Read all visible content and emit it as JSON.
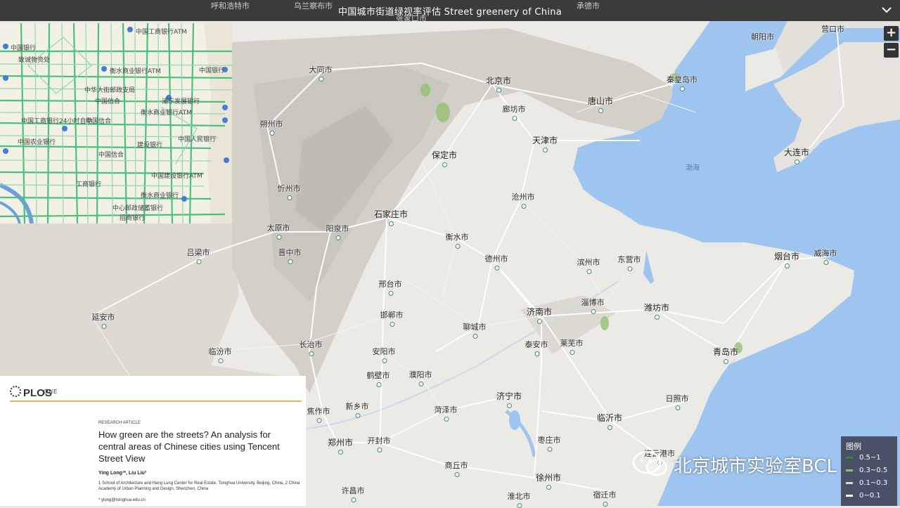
{
  "title": "中国城市街道绿视率评估 Street greenery of China",
  "top_labels": [
    "呼和浩特市",
    "乌兰察布市",
    "张家口市",
    "承德市",
    "朝阳市",
    "营口市"
  ],
  "zoom": {
    "in_label": "+",
    "out_label": "−"
  },
  "sea_label": "渤海",
  "cities": [
    {
      "name": "大同市",
      "big": false
    },
    {
      "name": "北京市",
      "big": true
    },
    {
      "name": "唐山市",
      "big": true
    },
    {
      "name": "秦皇岛市",
      "big": false
    },
    {
      "name": "廊坊市",
      "big": false
    },
    {
      "name": "天津市",
      "big": true
    },
    {
      "name": "朔州市",
      "big": false
    },
    {
      "name": "保定市",
      "big": true
    },
    {
      "name": "大连市",
      "big": true
    },
    {
      "name": "沧州市",
      "big": false
    },
    {
      "name": "忻州市",
      "big": false
    },
    {
      "name": "石家庄市",
      "big": true
    },
    {
      "name": "太原市",
      "big": false
    },
    {
      "name": "阳泉市",
      "big": false
    },
    {
      "name": "衡水市",
      "big": false
    },
    {
      "name": "吕梁市",
      "big": false
    },
    {
      "name": "晋中市",
      "big": false
    },
    {
      "name": "德州市",
      "big": false
    },
    {
      "name": "滨州市",
      "big": false
    },
    {
      "name": "东营市",
      "big": false
    },
    {
      "name": "烟台市",
      "big": true
    },
    {
      "name": "威海市",
      "big": false
    },
    {
      "name": "邢台市",
      "big": false
    },
    {
      "name": "淄博市",
      "big": false
    },
    {
      "name": "延安市",
      "big": false
    },
    {
      "name": "邯郸市",
      "big": false
    },
    {
      "name": "济南市",
      "big": true
    },
    {
      "name": "潍坊市",
      "big": true
    },
    {
      "name": "聊城市",
      "big": false
    },
    {
      "name": "长治市",
      "big": false
    },
    {
      "name": "泰安市",
      "big": false
    },
    {
      "name": "莱芜市",
      "big": false
    },
    {
      "name": "临汾市",
      "big": false
    },
    {
      "name": "安阳市",
      "big": false
    },
    {
      "name": "青岛市",
      "big": true
    },
    {
      "name": "鹤壁市",
      "big": false
    },
    {
      "name": "濮阳市",
      "big": false
    },
    {
      "name": "济宁市",
      "big": true
    },
    {
      "name": "日照市",
      "big": false
    },
    {
      "name": "焦作市",
      "big": false
    },
    {
      "name": "新乡市",
      "big": false
    },
    {
      "name": "菏泽市",
      "big": false
    },
    {
      "name": "临沂市",
      "big": true
    },
    {
      "name": "郑州市",
      "big": true
    },
    {
      "name": "开封市",
      "big": false
    },
    {
      "name": "枣庄市",
      "big": false
    },
    {
      "name": "连云港市",
      "big": false
    },
    {
      "name": "商丘市",
      "big": false
    },
    {
      "name": "徐州市",
      "big": true
    },
    {
      "name": "许昌市",
      "big": false
    },
    {
      "name": "淮北市",
      "big": false
    },
    {
      "name": "宿迁市",
      "big": false
    }
  ],
  "inset": {
    "labels": [
      "中国银行",
      "中国工商银行ATM",
      "致诚物资处",
      "衡水商业银行ATM",
      "中国银行",
      "中华大街邮政支局",
      "浦东发展银行",
      "衡水商业银行ATM",
      "中国信合",
      "中国工商银行24小时自助",
      "中国信合",
      "建设银行",
      "中国人民银行",
      "中国信合",
      "中国农业银行",
      "中国建设银行ATM",
      "工商银行",
      "衡水商业银行",
      "中心邮政储蓄银行",
      "招商银行"
    ]
  },
  "paper": {
    "logo": "PLOS",
    "journal": "ONE",
    "kind": "RESEARCH ARTICLE",
    "title": "How green are the streets? An analysis for central areas of Chinese cities using Tencent Street View",
    "authors": "Ying Long¹*, Liu Liu²",
    "affiliation": "1 School of Architecture and Hang Lung Center for Real Estate, Tsinghua University, Beijing, China, 2 China Academy of Urban Planning and Design, Shenzhen, China",
    "email": "* ylong@tsinghua.edu.cn"
  },
  "legend": {
    "title": "图例",
    "items": [
      {
        "label": "0.5~1",
        "color": "#2e8b3a"
      },
      {
        "label": "0.3~0.5",
        "color": "#7cc47a"
      },
      {
        "label": "0.1~0.3",
        "color": "#c9e6c2"
      },
      {
        "label": "0~0.1",
        "color": "#ffffff"
      }
    ]
  },
  "watermark": "北京城市实验室BCL",
  "colors": {
    "sea": "#9ec4f0",
    "land": "#e9e8e3",
    "street_green": "#46c27a"
  }
}
